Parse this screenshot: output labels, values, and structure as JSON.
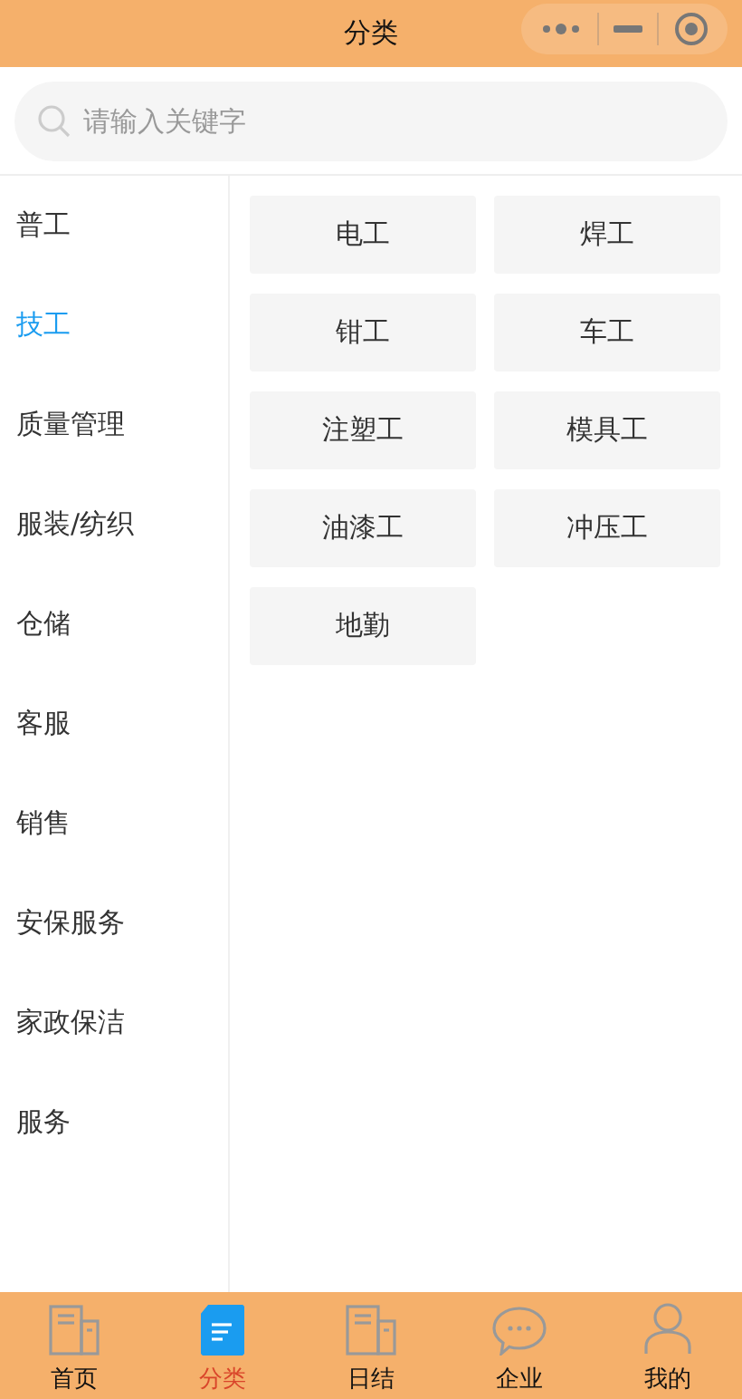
{
  "window": {
    "title": "分类"
  },
  "search": {
    "placeholder": "请输入关键字"
  },
  "categories": [
    {
      "label": "普工",
      "selected": false
    },
    {
      "label": "技工",
      "selected": true
    },
    {
      "label": "质量管理",
      "selected": false
    },
    {
      "label": "服装/纺织",
      "selected": false
    },
    {
      "label": "仓储",
      "selected": false
    },
    {
      "label": "客服",
      "selected": false
    },
    {
      "label": "销售",
      "selected": false
    },
    {
      "label": "安保服务",
      "selected": false
    },
    {
      "label": "家政保洁",
      "selected": false
    },
    {
      "label": "服务",
      "selected": false
    }
  ],
  "subcategories": [
    "电工",
    "焊工",
    "钳工",
    "车工",
    "注塑工",
    "模具工",
    "油漆工",
    "冲压工",
    "地勤"
  ],
  "tabs": [
    {
      "label": "首页",
      "selected": false
    },
    {
      "label": "分类",
      "selected": true
    },
    {
      "label": "日结",
      "selected": false
    },
    {
      "label": "企业",
      "selected": false
    },
    {
      "label": "我的",
      "selected": false
    }
  ]
}
